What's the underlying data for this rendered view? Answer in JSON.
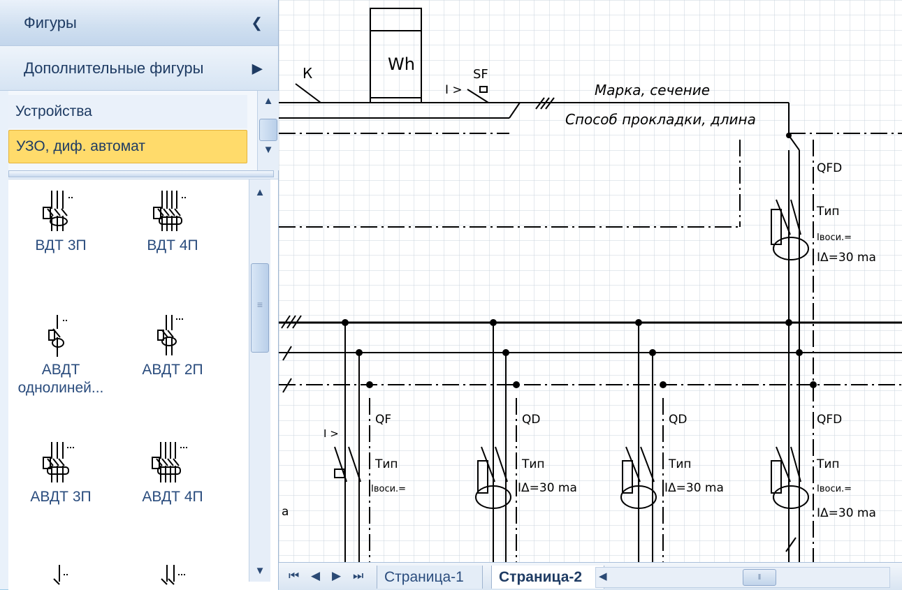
{
  "shapes_pane": {
    "title": "Фигуры",
    "collapse_icon": "chevron-left-icon",
    "more_shapes": "Дополнительные фигуры",
    "more_icon": "triangle-right-icon",
    "stencils": [
      {
        "label": "Устройства",
        "selected": false
      },
      {
        "label": "УЗО, диф. автомат",
        "selected": true
      }
    ],
    "items": [
      {
        "label": "ВДТ 3П",
        "icon": "rcd-3p-icon"
      },
      {
        "label": "ВДТ 4П",
        "icon": "rcd-4p-icon"
      },
      {
        "label": "АВДТ однолиней...",
        "icon": "rcbo-single-line-icon"
      },
      {
        "label": "АВДТ 2П",
        "icon": "rcbo-2p-icon"
      },
      {
        "label": "АВДТ 3П",
        "icon": "rcbo-3p-icon"
      },
      {
        "label": "АВДТ 4П",
        "icon": "rcbo-4p-icon"
      },
      {
        "label": "",
        "icon": "shape-partial-1-icon"
      },
      {
        "label": "",
        "icon": "shape-partial-2-icon"
      }
    ]
  },
  "diagram": {
    "meter_label": "Wh",
    "switch_label": "К",
    "breaker_label": "SF",
    "overcurrent_label": "I >",
    "cable_brand": "Марка, сечение",
    "cable_laying": "Способ прокладки, длина",
    "qfd_top": {
      "name": "QFD",
      "type": "Тип",
      "rating": "Iвоси.=",
      "leak": "IΔ=30  mа"
    },
    "branches": [
      {
        "name": "QF",
        "type": "Тип",
        "rating": "Iвоси.=",
        "overcurrent": "I >"
      },
      {
        "name": "QD",
        "type": "Тип",
        "leak": "IΔ=30  mа"
      },
      {
        "name": "QD",
        "type": "Тип",
        "leak": "IΔ=30  mа"
      },
      {
        "name": "QFD",
        "type": "Тип",
        "rating": "Iвоси.=",
        "leak": "IΔ=30  mа"
      }
    ],
    "left_edge_label": "a"
  },
  "tabbar": {
    "nav_icons": [
      "first-page-icon",
      "prev-page-icon",
      "next-page-icon",
      "last-page-icon"
    ],
    "tabs": [
      {
        "label": "Страница-1",
        "active": false
      },
      {
        "label": "Страница-2",
        "active": true
      }
    ]
  }
}
